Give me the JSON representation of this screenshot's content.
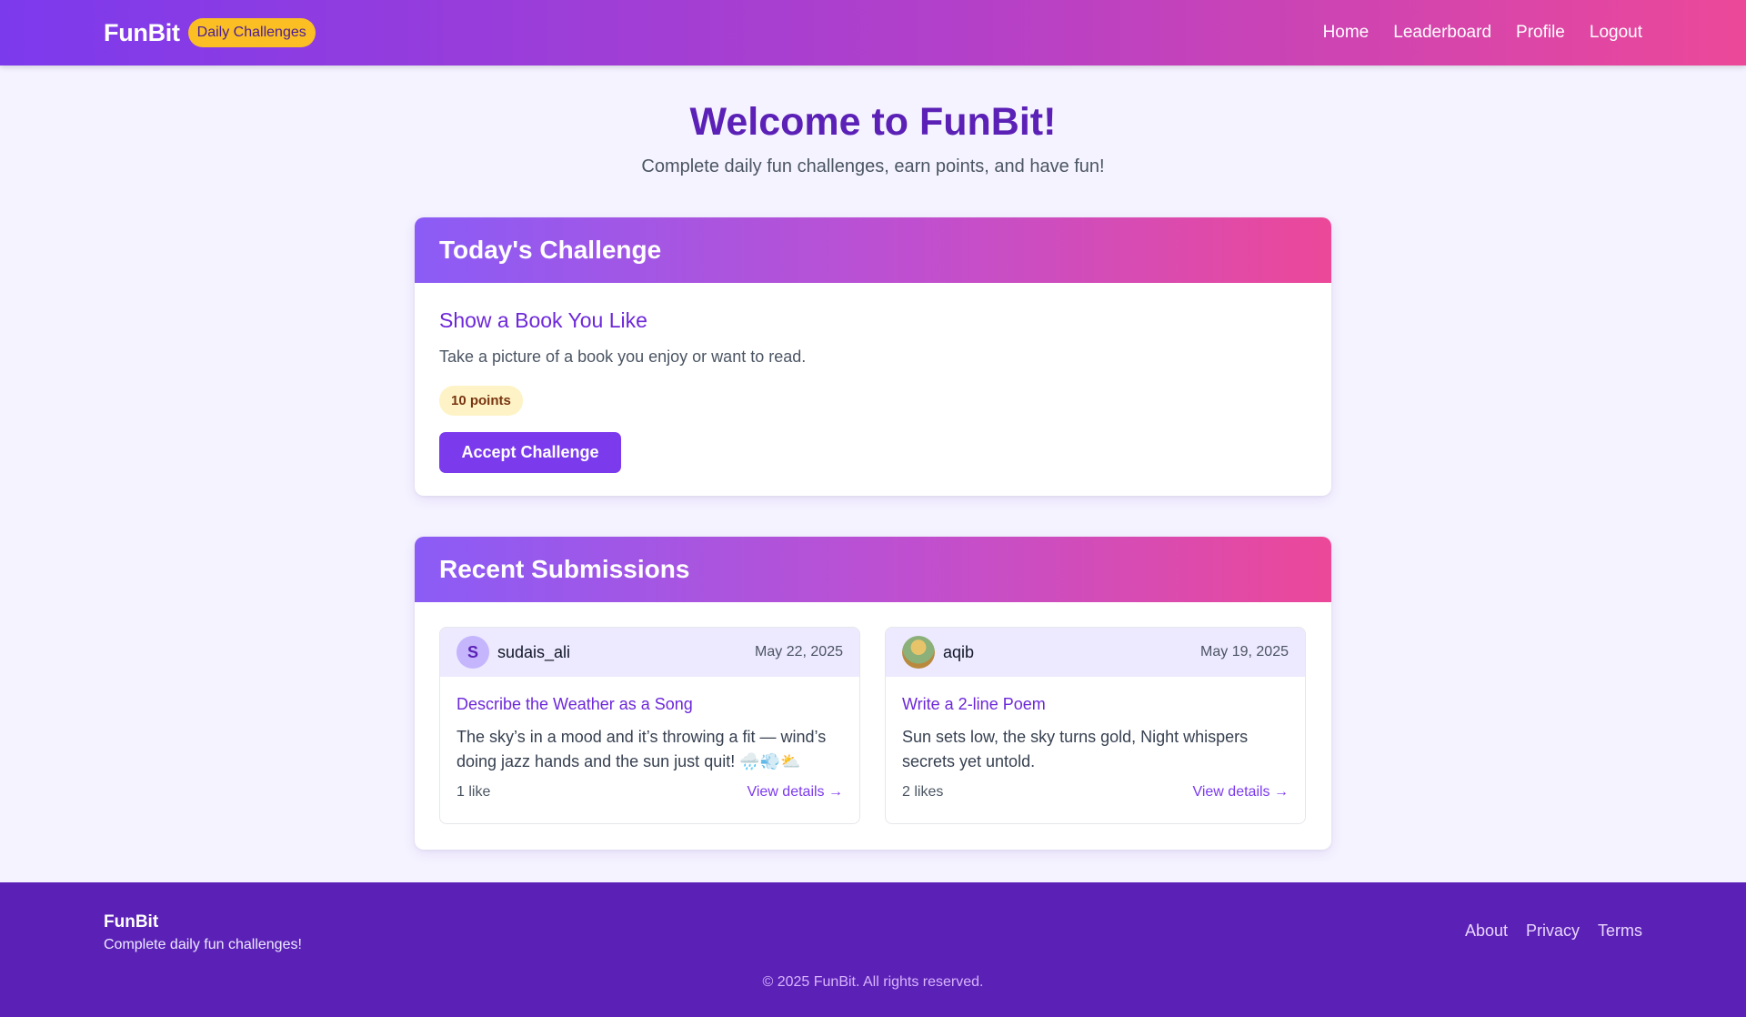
{
  "header": {
    "brand": "FunBit",
    "badge": "Daily Challenges",
    "nav": [
      "Home",
      "Leaderboard",
      "Profile",
      "Logout"
    ]
  },
  "hero": {
    "title": "Welcome to FunBit!",
    "subtitle": "Complete daily fun challenges, earn points, and have fun!"
  },
  "today": {
    "heading": "Today's Challenge",
    "title": "Show a Book You Like",
    "description": "Take a picture of a book you enjoy or want to read.",
    "points": "10 points",
    "button": "Accept Challenge"
  },
  "recent": {
    "heading": "Recent Submissions",
    "items": [
      {
        "avatar_letter": "S",
        "username": "sudais_ali",
        "date": "May 22, 2025",
        "title": "Describe the Weather as a Song",
        "text": "The sky’s in a mood and it’s throwing a fit — wind’s doing jazz hands and the sun just quit! 🌧️💨⛅",
        "likes": "1 like",
        "link": "View details →"
      },
      {
        "avatar_letter": "",
        "username": "aqib",
        "date": "May 19, 2025",
        "title": "Write a 2-line Poem",
        "text": "Sun sets low, the sky turns gold, Night whispers secrets yet untold.",
        "likes": "2 likes",
        "link": "View details →"
      }
    ]
  },
  "footer": {
    "brand": "FunBit",
    "tagline": "Complete daily fun challenges!",
    "links": [
      "About",
      "Privacy",
      "Terms"
    ],
    "copyright": "© 2025 FunBit. All rights reserved."
  },
  "colors": {
    "primary": "#7c3aed",
    "accent": "#ec4899",
    "badge": "#fbbf24",
    "footer": "#5b21b6"
  }
}
